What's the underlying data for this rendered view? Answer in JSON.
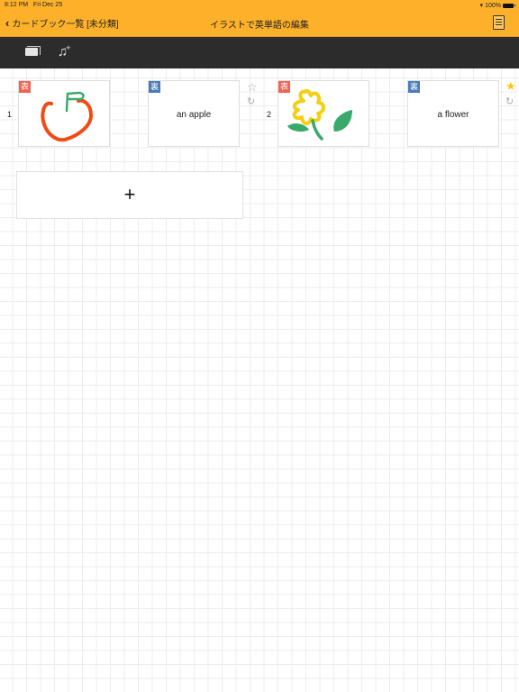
{
  "status_bar": {
    "time": "8:12 PM",
    "date": "Fri Dec 25",
    "battery": "100%"
  },
  "header": {
    "back_label": "カードブック一覧 [未分類]",
    "title": "イラストで英単語の編集",
    "color": "#fdb12a"
  },
  "toolbar": {
    "icons": [
      "add-card-deck-icon",
      "add-music-icon"
    ]
  },
  "cards": [
    {
      "number": "1",
      "front_badge": "表",
      "back_badge": "裏",
      "front_image": "apple-drawing",
      "back_text": "an apple",
      "starred": false
    },
    {
      "number": "2",
      "front_badge": "表",
      "back_badge": "裏",
      "front_image": "flower-drawing",
      "back_text": "a flower",
      "starred": true
    }
  ],
  "add_card": {
    "label": "+"
  },
  "colors": {
    "front_badge": "#f26353",
    "back_badge": "#4a7cb7",
    "star_active": "#f6c915"
  }
}
